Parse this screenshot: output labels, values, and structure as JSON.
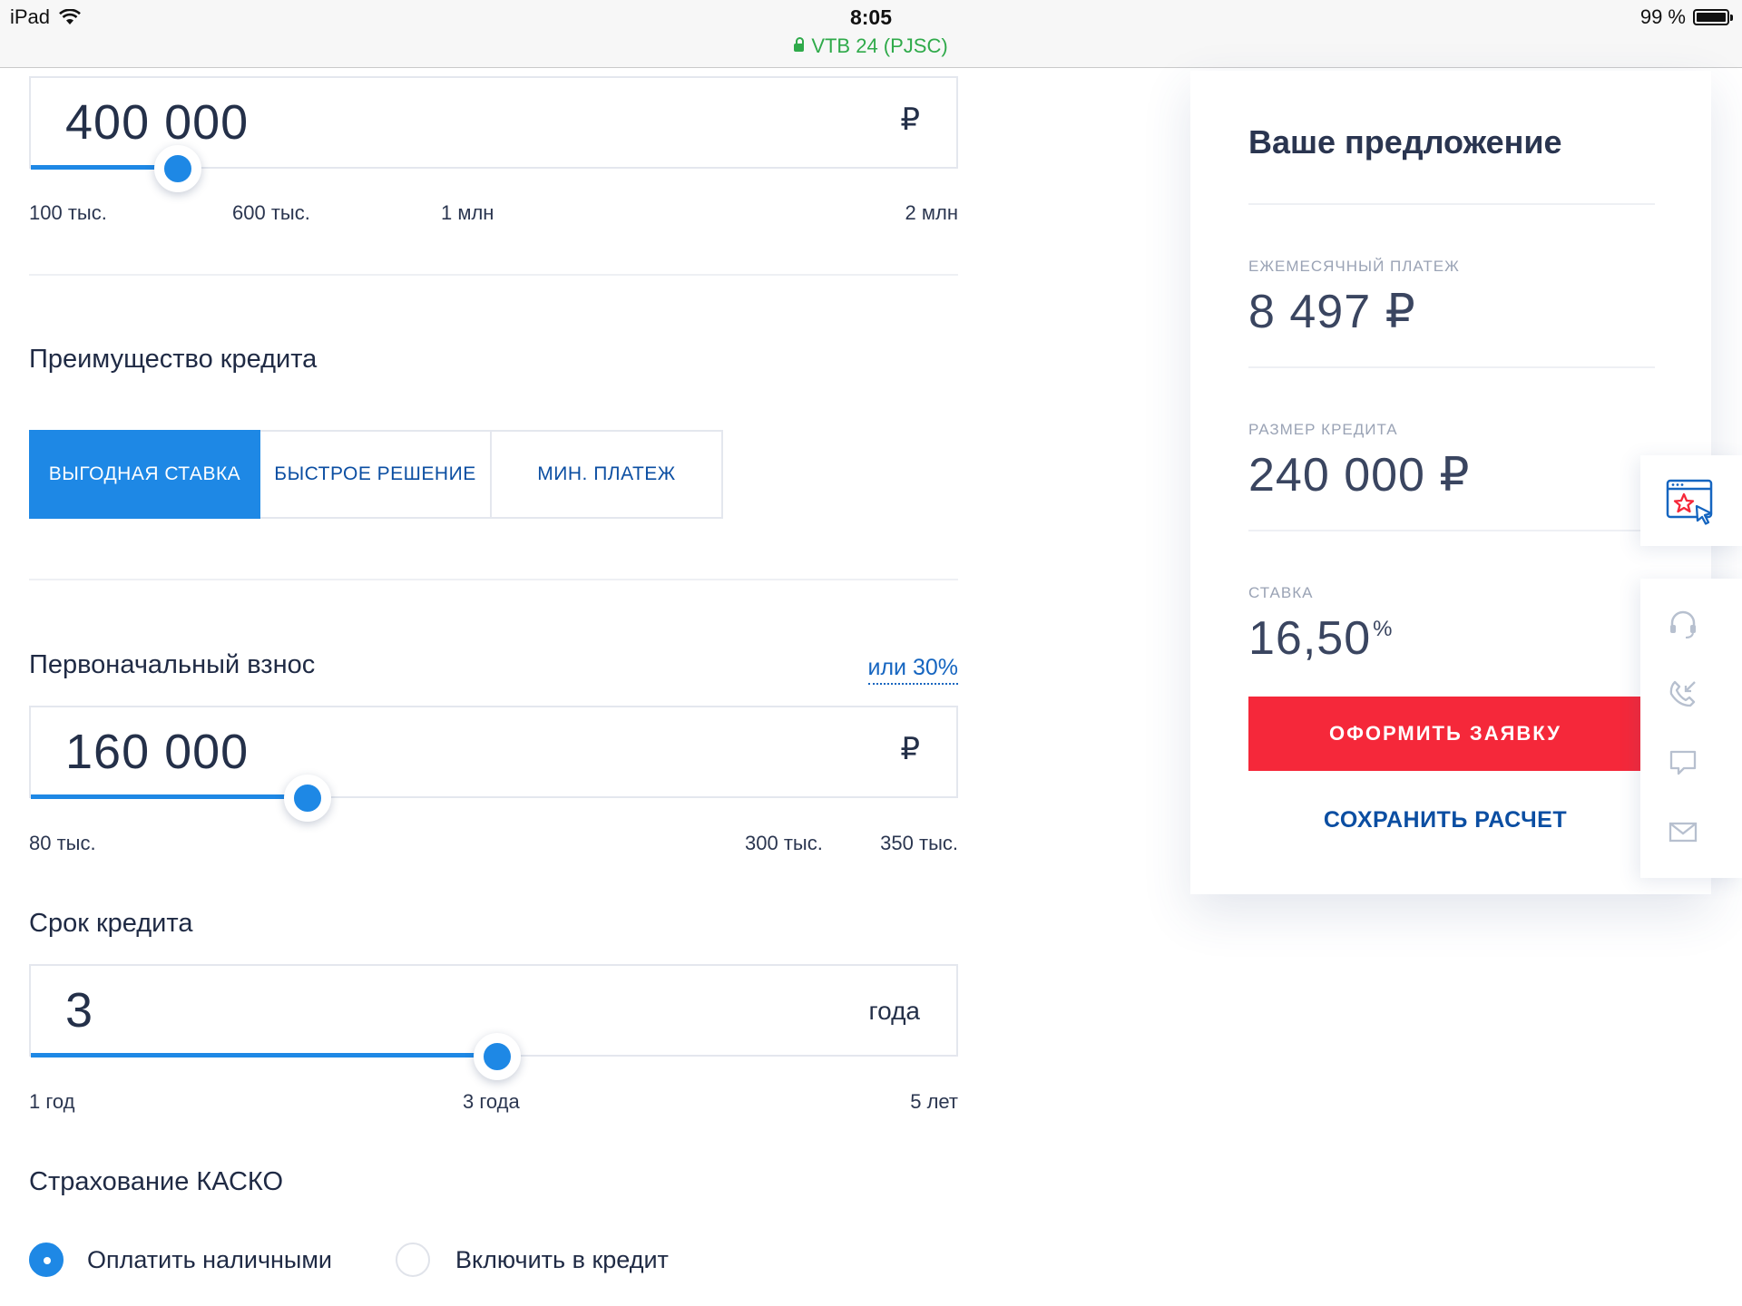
{
  "status_bar": {
    "device": "iPad",
    "time": "8:05",
    "site": "VTB 24 (PJSC)",
    "battery": "99 %"
  },
  "loan_amount": {
    "value": "400 000",
    "currency": "₽",
    "slider_fraction": 0.16,
    "scale": [
      "100 тыс.",
      "600 тыс.",
      "1 млн",
      "2 млн"
    ]
  },
  "advantage": {
    "heading": "Преимущество кредита",
    "options": [
      "ВЫГОДНАЯ СТАВКА",
      "БЫСТРОЕ РЕШЕНИЕ",
      "МИН. ПЛАТЕЖ"
    ],
    "selected": "ВЫГОДНАЯ СТАВКА"
  },
  "down_payment": {
    "heading": "Первоначальный взнос",
    "alt_link": "или 30%",
    "value": "160 000",
    "currency": "₽",
    "slider_fraction": 0.3,
    "scale": [
      "80 тыс.",
      "300 тыс.",
      "350 тыс."
    ]
  },
  "term": {
    "heading": "Срок кредита",
    "value": "3",
    "unit": "года",
    "slider_fraction": 0.504,
    "scale": [
      "1 год",
      "3 года",
      "5 лет"
    ]
  },
  "casco": {
    "heading": "Страхование КАСКО",
    "options": [
      "Оплатить наличными",
      "Включить в кредит"
    ],
    "selected": "Оплатить наличными"
  },
  "offer": {
    "title": "Ваше предложение",
    "monthly_label": "ЕЖЕМЕСЯЧНЫЙ ПЛАТЕЖ",
    "monthly_value": "8 497 ₽",
    "credit_label": "РАЗМЕР КРЕДИТА",
    "credit_value": "240 000 ₽",
    "rate_label": "СТАВКА",
    "rate_value": "16,50",
    "rate_unit": "%",
    "apply_button": "ОФОРМИТЬ ЗАЯВКУ",
    "save_link": "СОХРАНИТЬ РАСЧЕТ"
  },
  "side_tools": [
    "favorite-page-icon",
    "headset-icon",
    "callback-phone-icon",
    "chat-icon",
    "mail-icon"
  ],
  "colors": {
    "accent": "#1e88e5",
    "primary_text": "#1f2a44",
    "cta": "#f5283a",
    "link": "#0b4ea2",
    "secure": "#2faa4a"
  }
}
